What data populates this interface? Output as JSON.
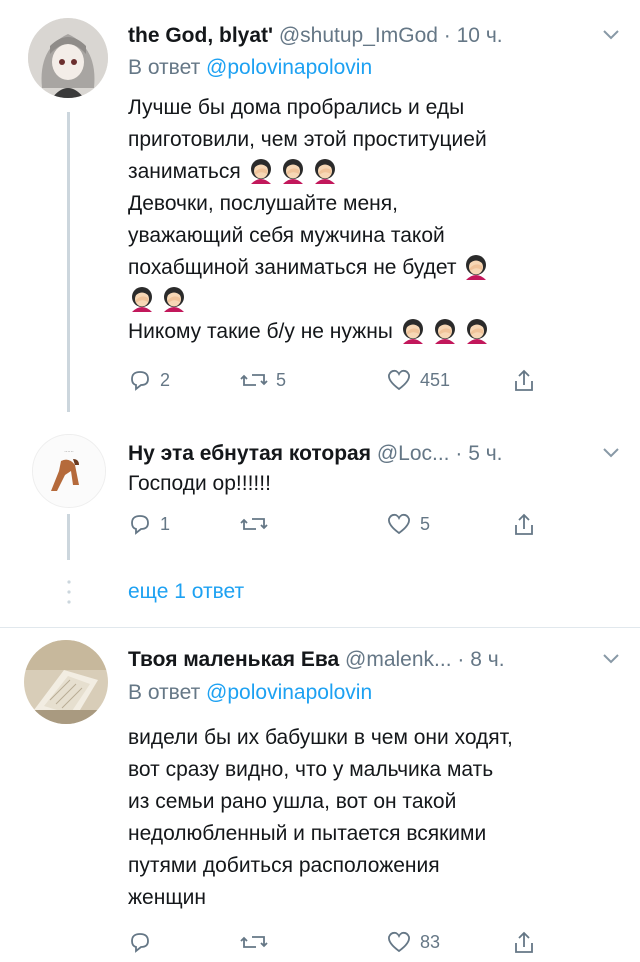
{
  "tweets": [
    {
      "name": "the God, blyat'",
      "handle": "@shutup_ImGod",
      "time": "10 ч.",
      "reply_prefix": "В ответ",
      "reply_to": "@polovinapolovin",
      "lines": [
        "Лучше бы дома пробрались и еды",
        "приготовили, чем этой проституцией",
        "заниматься",
        "Девочки, послушайте меня,",
        "уважающий себя мужчина такой",
        "похабщиной заниматься не будет",
        "",
        "Никому такие б/у не нужны"
      ],
      "replies": "2",
      "retweets": "5",
      "likes": "451"
    },
    {
      "name": "Ну эта ебнутая которая",
      "handle": "@Loc...",
      "time": "5 ч.",
      "lines": [
        "Господи ор!!!!!!"
      ],
      "replies": "1",
      "retweets": "",
      "likes": "5"
    },
    {
      "name": "Твоя маленькая Ева",
      "handle": "@malenk...",
      "time": "8 ч.",
      "reply_prefix": "В ответ",
      "reply_to": "@polovinapolovin",
      "lines": [
        "видели бы их бабушки в чем они ходят,",
        "вот сразу видно, что у мальчика мать",
        "из семьи рано ушла, вот он такой",
        "недолюбленный и пытается всякими",
        "путями добиться расположения",
        "женщин"
      ],
      "replies": "",
      "retweets": "",
      "likes": "83"
    }
  ],
  "show_more": "еще 1 ответ",
  "icons": {
    "emoji": "woman-facepalming-emoji",
    "reply": "reply-icon",
    "retweet": "retweet-icon",
    "like": "heart-icon",
    "share": "share-icon"
  },
  "colors": {
    "link": "#1da1f2",
    "muted": "#657786",
    "text": "#14171a"
  }
}
